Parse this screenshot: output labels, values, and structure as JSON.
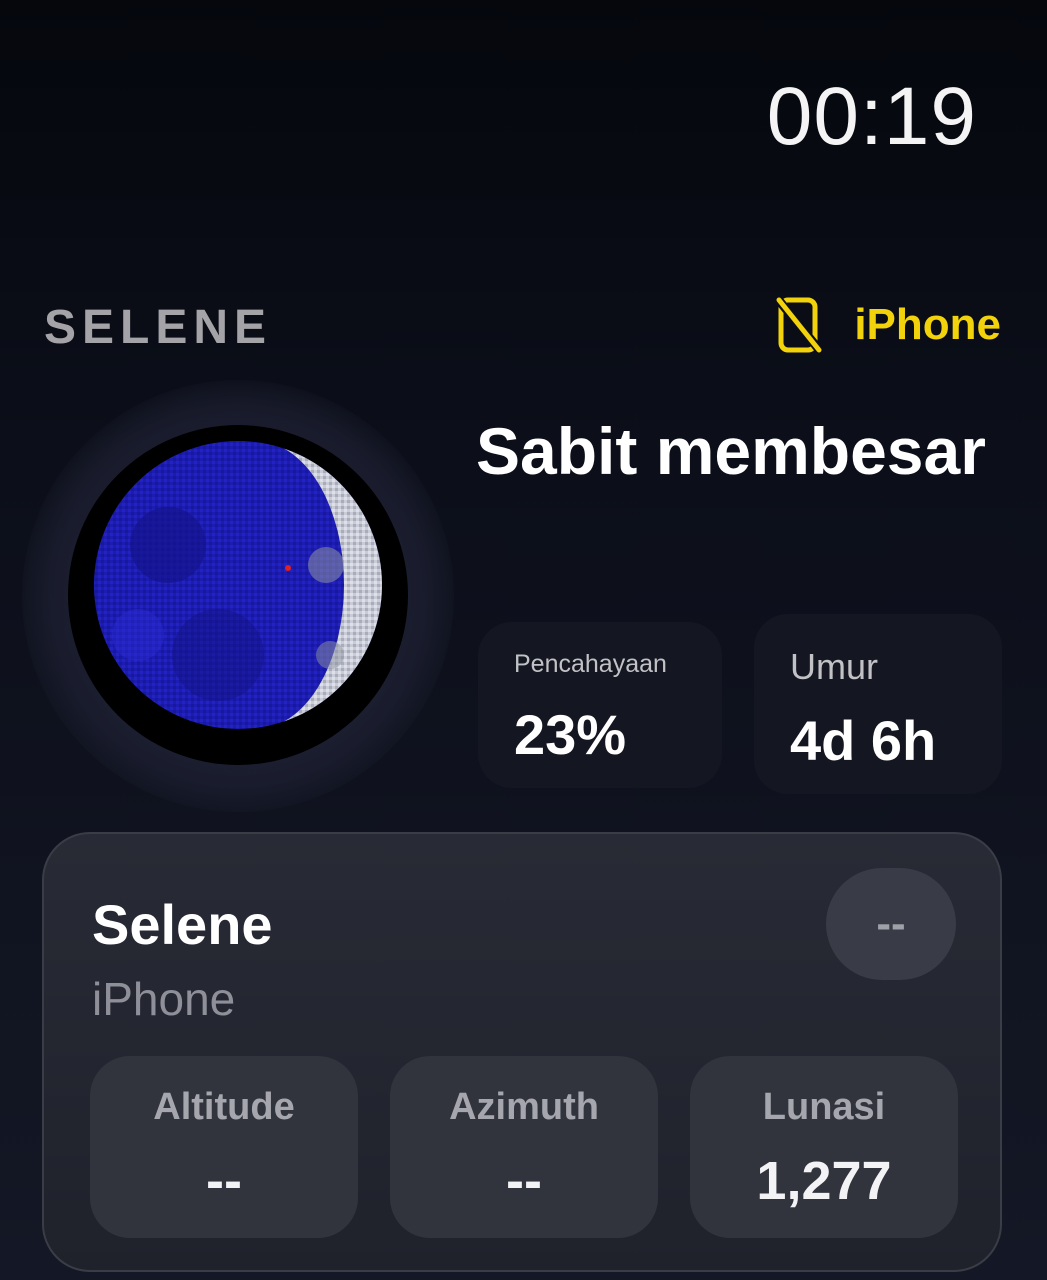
{
  "status_bar": {
    "time": "00:19"
  },
  "header": {
    "app_name": "SELENE",
    "device_label": "iPhone",
    "device_icon": "phone-slash-icon",
    "accent_color": "#f2d20a"
  },
  "moon": {
    "phase_name": "Sabit membesar",
    "illumination": {
      "label": "Pencahayaan",
      "value": "23%"
    },
    "age": {
      "label": "Umur",
      "value": "4d 6h"
    }
  },
  "panel": {
    "title": "Selene",
    "subtitle": "iPhone",
    "status": "--",
    "metrics": [
      {
        "label": "Altitude",
        "value": "--"
      },
      {
        "label": "Azimuth",
        "value": "--"
      },
      {
        "label": "Lunasi",
        "value": "1,277"
      }
    ]
  }
}
